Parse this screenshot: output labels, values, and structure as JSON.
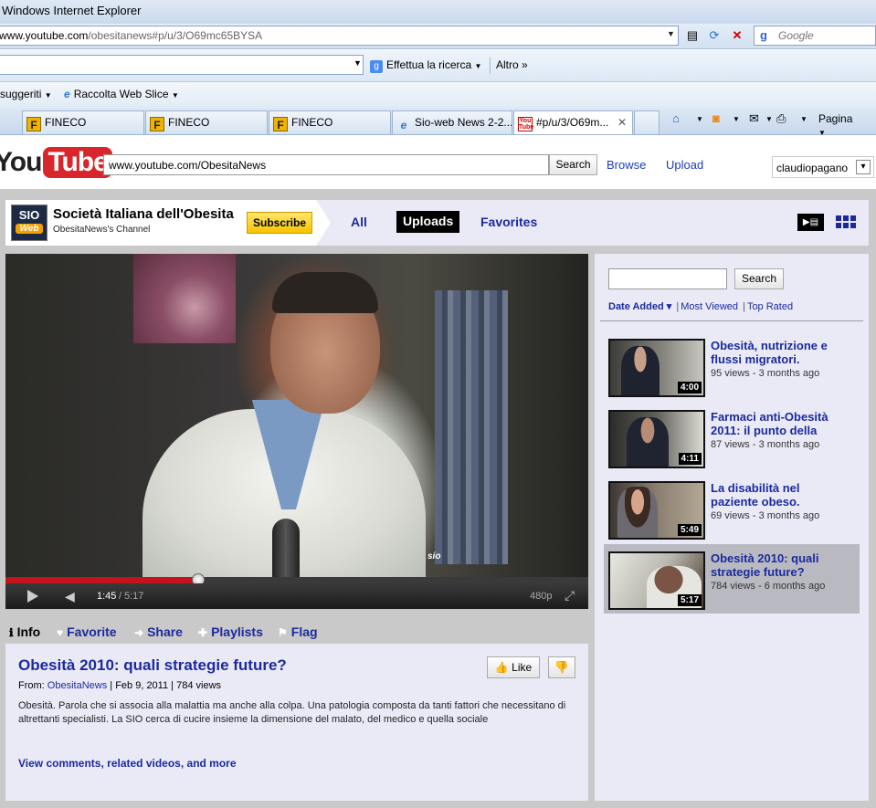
{
  "browser": {
    "title": "Windows Internet Explorer",
    "address_host": "www.youtube.com",
    "address_path": "/obesitanews#p/u/3/O69mc65BYSA",
    "search_provider": "Google",
    "toolbar_search_label": "Effettua la ricerca",
    "toolbar_more_label": "Altro",
    "favorites_suggested": "suggeriti",
    "favorites_webslice": "Raccolta Web Slice",
    "tabs": [
      {
        "label": "FINECO",
        "icon": "fineco-favicon"
      },
      {
        "label": "FINECO",
        "icon": "fineco-favicon"
      },
      {
        "label": "FINECO",
        "icon": "fineco-favicon"
      },
      {
        "label": "Sio-web News 2-2...",
        "icon": "ie-favicon"
      },
      {
        "label": "#p/u/3/O69m...",
        "icon": "youtube-favicon"
      }
    ],
    "page_menu_label": "Pagina"
  },
  "youtube": {
    "logo_you": "You",
    "logo_tube": "Tube",
    "search_value": "www.youtube.com/ObesitaNews",
    "search_button": "Search",
    "browse_label": "Browse",
    "upload_label": "Upload",
    "username": "claudiopagano"
  },
  "channel": {
    "logo_top": "SIO",
    "logo_bottom": "Web",
    "name": "Società Italiana dell'Obesita",
    "subtitle": "ObesitaNews's Channel",
    "subscribe_label": "Subscribe",
    "tabs": {
      "all": "All",
      "uploads": "Uploads",
      "favorites": "Favorites"
    }
  },
  "player": {
    "current_time": "1:45",
    "separator": "/",
    "total_time": "5:17",
    "progress_fraction": 0.33,
    "quality": "480p"
  },
  "info_tabs": {
    "info": "Info",
    "favorite": "Favorite",
    "share": "Share",
    "playlists": "Playlists",
    "flag": "Flag"
  },
  "video": {
    "title": "Obesità 2010: quali strategie future?",
    "like_label": "Like",
    "from_label": "From:",
    "author": "ObesitaNews",
    "date": "Feb 9, 2011",
    "views": "784 views",
    "description": "Obesità. Parola che si associa alla malattia ma anche alla colpa. Una patologia composta da tanti fattori che necessitano di altrettanti specialisti. La SIO cerca di cucire insieme la dimensione del malato, del medico e quella sociale",
    "more_link": "View comments, related videos, and more"
  },
  "sidebar": {
    "search_button": "Search",
    "sort_date": "Date Added",
    "sort_views": "Most Viewed",
    "sort_rated": "Top Rated",
    "videos": [
      {
        "title": "Obesità, nutrizione e flussi migratori.",
        "meta": "95 views - 3 months ago",
        "duration": "4:00"
      },
      {
        "title": "Farmaci anti-Obesità 2011: il punto della",
        "meta": "87 views - 3 months ago",
        "duration": "4:11"
      },
      {
        "title": "La disabilità nel paziente obeso.",
        "meta": "69 views - 3 months ago",
        "duration": "5:49"
      },
      {
        "title": "Obesità 2010: quali strategie future?",
        "meta": "784 views - 6 months ago",
        "duration": "5:17"
      }
    ]
  },
  "colors": {
    "link_blue": "#1c2a9c",
    "youtube_red": "#d9262c",
    "subscribe_yellow": "#f8c400",
    "panel_bg": "#eaeaf7"
  }
}
